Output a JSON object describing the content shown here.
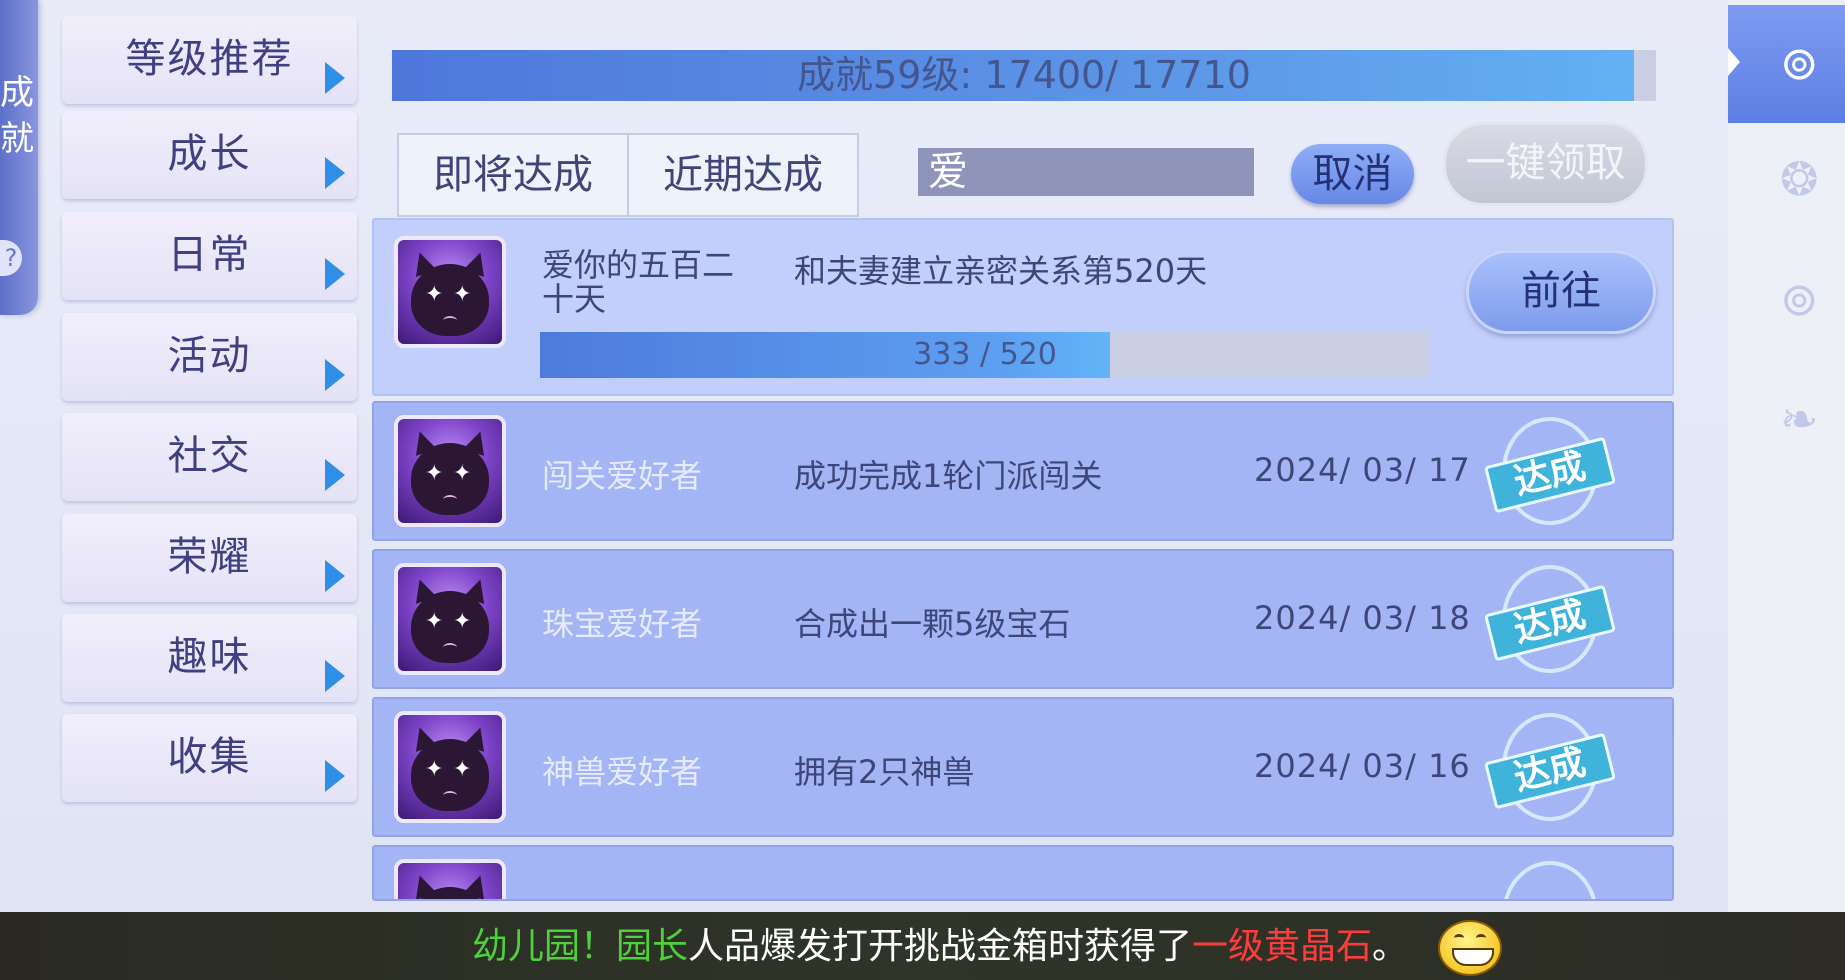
{
  "left_tab": {
    "label": "成就",
    "help": "?"
  },
  "categories": [
    "等级推荐",
    "成长",
    "日常",
    "活动",
    "社交",
    "荣耀",
    "趣味",
    "收集"
  ],
  "top_progress": {
    "text": "成就59级: 17400/ 17710",
    "current": 17400,
    "total": 17710
  },
  "tabs": [
    "即将达成",
    "近期达成"
  ],
  "search": {
    "value": "爱"
  },
  "buttons": {
    "cancel": "取消",
    "claim_all": "一键领取",
    "goto": "前往"
  },
  "achievements": [
    {
      "name": "爱你的五百二十天",
      "desc": "和夫妻建立亲密关系第520天",
      "progress_text": "333 /  520",
      "current": 333,
      "total": 520
    },
    {
      "name": "闯关爱好者",
      "desc": "成功完成1轮门派闯关",
      "date": "2024/ 03/ 17",
      "status": "达成"
    },
    {
      "name": "珠宝爱好者",
      "desc": "合成出一颗5级宝石",
      "date": "2024/ 03/ 18",
      "status": "达成"
    },
    {
      "name": "神兽爱好者",
      "desc": "拥有2只神兽",
      "date": "2024/ 03/ 16",
      "status": "达成"
    }
  ],
  "right_icons": [
    "achievement-icon",
    "creature-icon",
    "medal-icon",
    "fish-icon"
  ],
  "chat": {
    "part1": "幼儿园！园长",
    "part2": "人品爆发打开挑战金箱时获得了",
    "part3": "一级黄晶石",
    "part4": "。"
  }
}
